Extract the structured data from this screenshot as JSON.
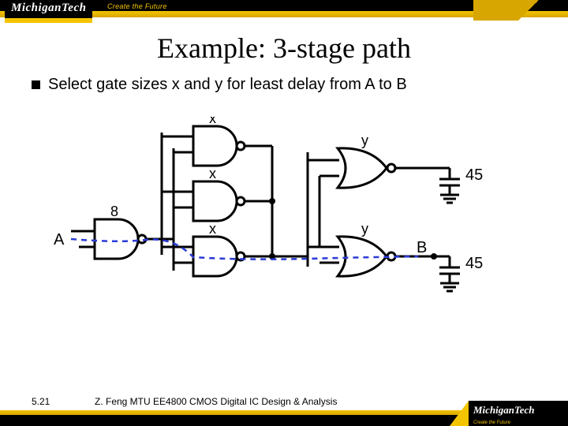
{
  "brand": {
    "name": "MichiganTech",
    "tagline": "Create the Future"
  },
  "title": "Example: 3-stage path",
  "bullet": "Select gate sizes x and y for least delay from A to B",
  "diagram": {
    "input_label": "A",
    "input_cap": "8",
    "stage1_sizes": [
      "x",
      "x",
      "x"
    ],
    "stage2_sizes": [
      "y",
      "y"
    ],
    "output_label": "B",
    "load_values": [
      "45",
      "45"
    ]
  },
  "footer": {
    "page": "5.21",
    "credit": "Z. Feng  MTU EE4800 CMOS Digital IC Design & Analysis"
  }
}
